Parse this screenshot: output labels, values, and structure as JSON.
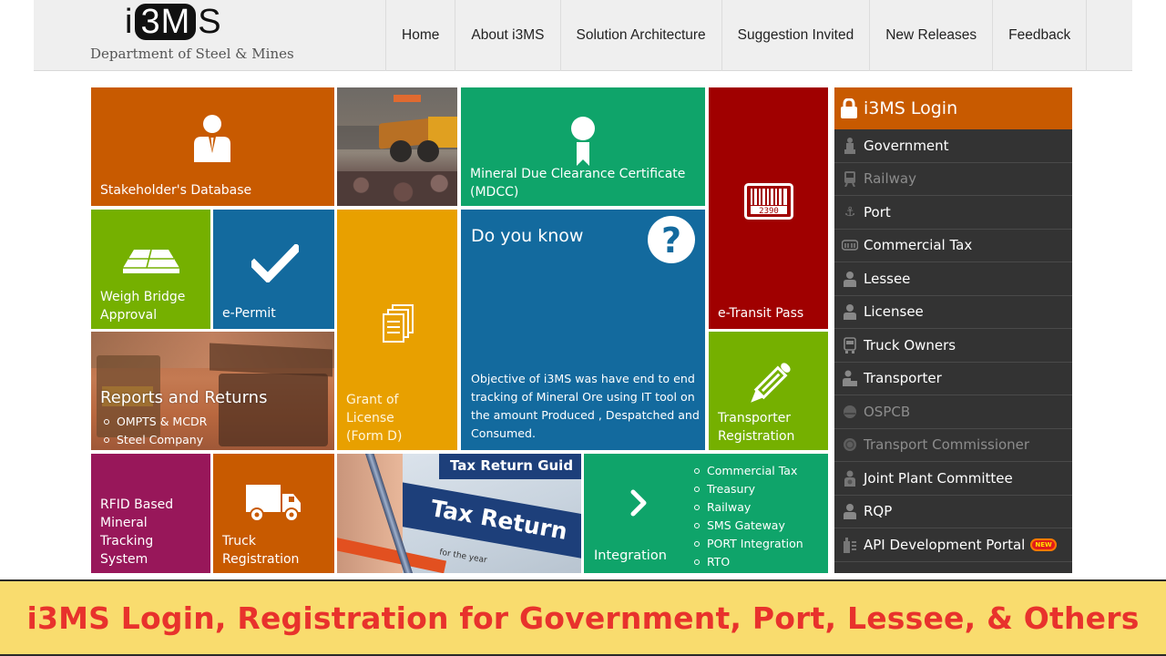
{
  "header": {
    "logo_mark_prefix": "i",
    "logo_mark_pill": "3M",
    "logo_mark_suffix": "S",
    "logo_subtitle": "Department of Steel & Mines",
    "nav": [
      {
        "label": "Home"
      },
      {
        "label": "About i3MS"
      },
      {
        "label": "Solution Architecture"
      },
      {
        "label": "Suggestion Invited"
      },
      {
        "label": "New Releases"
      },
      {
        "label": "Feedback"
      }
    ]
  },
  "tiles": {
    "stakeholder": {
      "label": "Stakeholder's Database",
      "icon": "person-tie-icon",
      "color": "#c85a00"
    },
    "mdcc": {
      "label_line1": "Mineral Due Clearance Certificate",
      "label_line2": "(MDCC)",
      "icon": "award-ribbon-icon",
      "color": "#0fa46a"
    },
    "etransit": {
      "label": "e-Transit Pass",
      "icon": "barcode-icon",
      "barcode_number": "2390",
      "color": "#a00000"
    },
    "weighbridge": {
      "label_line1": "Weigh Bridge",
      "label_line2": "Approval",
      "icon": "weigh-platform-icon",
      "color": "#75b000"
    },
    "epermit": {
      "label": "e-Permit",
      "icon": "checkmark-icon",
      "color": "#136a9e"
    },
    "grant": {
      "label_line1": "Grant of",
      "label_line2": "License",
      "label_line3": "(Form D)",
      "icon": "documents-icon",
      "color": "#e8a000"
    },
    "doyouknow": {
      "title": "Do you know",
      "icon": "question-circle-icon",
      "text": "Objective of i3MS was have end to end tracking of Mineral Ore using IT tool on the amount Produced , Despatched and Consumed.",
      "color": "#136a9e"
    },
    "transporter_reg": {
      "label_line1": "Transporter",
      "label_line2": "Registration",
      "icon": "pencil-icon",
      "color": "#75b000"
    },
    "reports": {
      "title": "Reports and Returns",
      "items": [
        "OMPTS & MCDR",
        "Steel Company"
      ]
    },
    "rfid": {
      "label_line1": "RFID Based",
      "label_line2": "Mineral",
      "label_line3": "Tracking",
      "label_line4": "System",
      "color": "#98175a"
    },
    "truck_reg": {
      "label_line1": "Truck",
      "label_line2": "Registration",
      "icon": "truck-icon",
      "color": "#c85a00"
    },
    "taxreturn": {
      "heading_small": "Tax Return Guid",
      "heading_big": "Tax Return",
      "subtext": "for the year"
    },
    "integration": {
      "label": "Integration",
      "icon": "chevron-right-icon",
      "items": [
        "Commercial Tax",
        "Treasury",
        "Railway",
        "SMS Gateway",
        "PORT Integration",
        "RTO"
      ],
      "color": "#0fa46a"
    }
  },
  "sidebar": {
    "title": "i3MS Login",
    "items": [
      {
        "label": "Government",
        "icon": "emblem-icon",
        "dim": false
      },
      {
        "label": "Railway",
        "icon": "train-icon",
        "dim": true
      },
      {
        "label": "Port",
        "icon": "anchor-icon",
        "dim": false
      },
      {
        "label": "Commercial Tax",
        "icon": "ctd-icon",
        "dim": false
      },
      {
        "label": "Lessee",
        "icon": "user-icon",
        "dim": false
      },
      {
        "label": "Licensee",
        "icon": "user-icon",
        "dim": false
      },
      {
        "label": "Truck Owners",
        "icon": "truck-front-icon",
        "dim": false
      },
      {
        "label": "Transporter",
        "icon": "transporter-icon",
        "dim": false
      },
      {
        "label": "OSPCB",
        "icon": "ospcb-logo-icon",
        "dim": true
      },
      {
        "label": "Transport Commissioner",
        "icon": "seal-icon",
        "dim": true
      },
      {
        "label": "Joint Plant Committee",
        "icon": "jpc-logo-icon",
        "dim": false
      },
      {
        "label": "RQP",
        "icon": "user-icon",
        "dim": false
      },
      {
        "label": "API Development Portal",
        "icon": "api-icon",
        "dim": false,
        "badge": "NEW"
      }
    ]
  },
  "banner": {
    "text": "i3MS Login, Registration for Government, Port, Lessee, & Others"
  }
}
